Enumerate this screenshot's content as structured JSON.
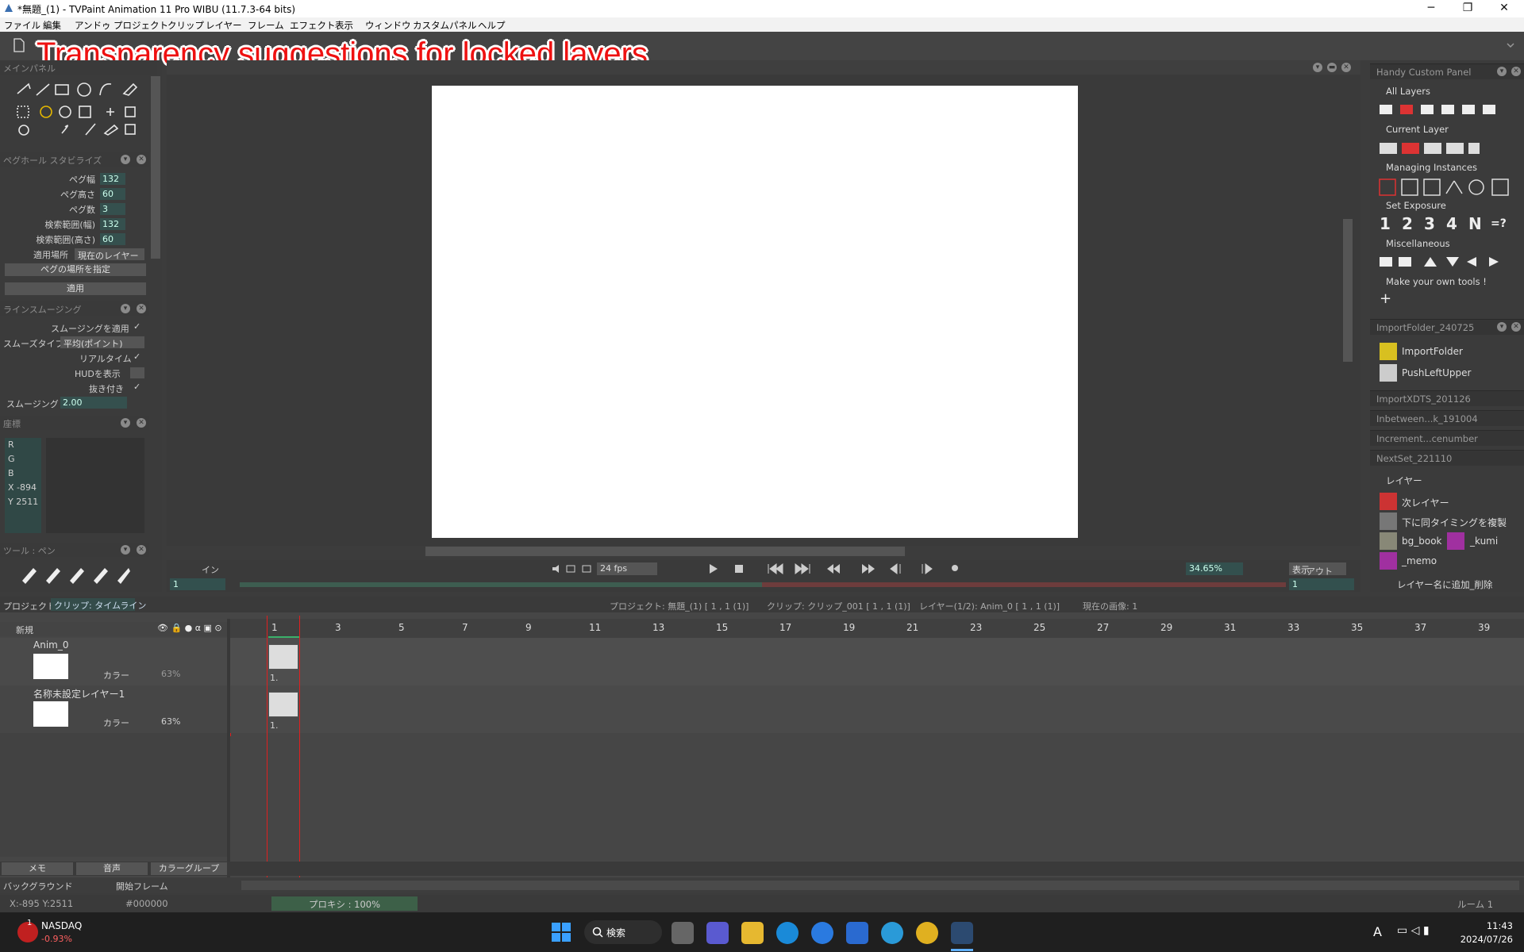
{
  "window": {
    "title": "*無題_(1) - TVPaint Animation 11 Pro WIBU (11.7.3-64 bits)"
  },
  "menu": [
    "ファイル",
    "編集",
    "アンドゥ",
    "プロジェクト",
    "クリップ",
    "レイヤー",
    "フレーム",
    "エフェクト",
    "表示",
    "ウィンドウ",
    "カスタムパネル",
    "ヘルプ"
  ],
  "annotation": "Transparency suggestions for locked layers",
  "left": {
    "main_panel": "メインパネル",
    "peg_title": "ペグホール スタビライズ",
    "peg_fields": [
      {
        "label": "ペグ幅",
        "value": "132"
      },
      {
        "label": "ペグ高さ",
        "value": "60"
      },
      {
        "label": "ペグ数",
        "value": "3"
      },
      {
        "label": "検索範囲(幅)",
        "value": "132"
      },
      {
        "label": "検索範囲(高さ)",
        "value": "60"
      }
    ],
    "apply_place_label": "適用場所",
    "apply_place_value": "現在のレイヤー",
    "peg_place_btn": "ペグの場所を指定",
    "apply_btn": "適用",
    "smooth_title": "ラインスムージング",
    "smooth_apply": "スムージングを適用",
    "smooth_type_label": "スムーズタイプ",
    "smooth_type_value": "平均(ポイント)",
    "realtime": "リアルタイム",
    "hud": "HUDを表示",
    "nuki": "抜き付き",
    "smoothing_label": "スムージング",
    "smoothing_value": "2.00",
    "coord_title": "座標",
    "coords": [
      "R",
      "G",
      "B",
      "X -894",
      "Y 2511"
    ],
    "tool_title": "ツール : ペン"
  },
  "canvas": {
    "fps": "24 fps",
    "zoom": "34.65%",
    "view": "表示",
    "in_label": "イン",
    "out_label": "アウト",
    "in_value": "1",
    "out_value": "1"
  },
  "right": {
    "handy_title": "Handy Custom Panel",
    "sections": [
      "All Layers",
      "Current Layer",
      "Managing Instances",
      "Set Exposure",
      "Miscellaneous",
      "Make your own tools !"
    ],
    "exposure": [
      "1",
      "2",
      "3",
      "4",
      "N",
      "=?"
    ],
    "import_folder_title": "ImportFolder_240725",
    "import_items": [
      "ImportFolder",
      "PushLeftUpper"
    ],
    "collapsed": [
      "ImportXDTS_201126",
      "Inbetween...k_191004",
      "Increment...cenumber"
    ],
    "nextset_title": "NextSet_221110",
    "nextset_section": "レイヤー",
    "nextset_items": [
      "次レイヤー",
      "下に同タイミングを複製",
      "bg_book",
      "_kumi",
      "_memo",
      "レイヤー名に追加_削除"
    ]
  },
  "timeline": {
    "tabs": [
      "プロジェクト",
      "クリップ: タイムライン"
    ],
    "info": [
      "プロジェクト: 無題_(1) [ 1 , 1  (1)]",
      "クリップ: クリップ_001 [ 1 , 1  (1)]",
      "レイヤー(1/2): Anim_0 [ 1 , 1  (1)]",
      "現在の画像: 1"
    ],
    "new_label": "新規",
    "frame_numbers": [
      "1",
      "3",
      "5",
      "7",
      "9",
      "11",
      "13",
      "15",
      "17",
      "19",
      "21",
      "23",
      "25",
      "27",
      "29",
      "31",
      "33",
      "35",
      "37",
      "39"
    ],
    "layers": [
      {
        "name": "Anim_0",
        "color_label": "カラー",
        "opacity": "63%",
        "frame": "1."
      },
      {
        "name": "名称未設定レイヤー1",
        "color_label": "カラー",
        "opacity": "63%",
        "frame": "1."
      }
    ],
    "bottom_tabs": [
      "メモ",
      "音声",
      "カラーグループ"
    ],
    "bg_label": "バックグラウンド",
    "start_frame": "開始フレーム"
  },
  "status": {
    "coords": "X:-895  Y:2511",
    "color": "#000000",
    "proxy": "プロキシ : 100%",
    "room": "ルーム 1"
  },
  "taskbar": {
    "stock": "NASDAQ",
    "change": "-0.93%",
    "badge": "1",
    "search": "検索",
    "time": "11:43",
    "date": "2024/07/26",
    "ime": "A"
  }
}
